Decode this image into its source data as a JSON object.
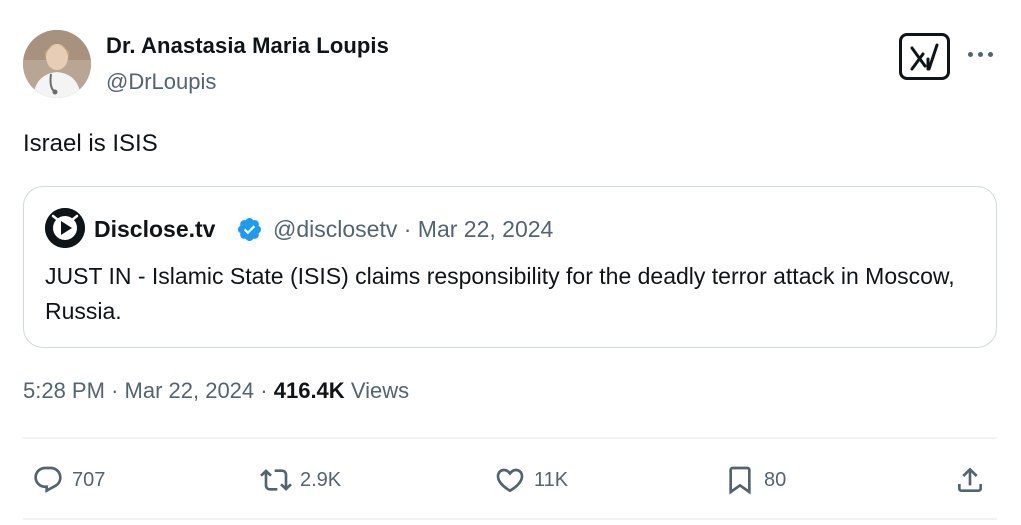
{
  "author": {
    "name": "Dr. Anastasia Maria Loupis",
    "handle": "@DrLoupis",
    "avatar_icon": "profile-photo-avatar"
  },
  "header_buttons": {
    "grok_icon": "grok-icon",
    "more_icon": "more-dots-icon"
  },
  "tweet": {
    "text": "Israel is ISIS"
  },
  "quoted_tweet": {
    "name": "Disclose.tv",
    "verified_icon": "verified-badge-icon",
    "handle": "@disclosetv",
    "separator": "·",
    "date": "Mar 22, 2024",
    "text": "JUST IN - Islamic State (ISIS) claims responsibility for the deadly terror attack in Moscow, Russia."
  },
  "meta": {
    "time": "5:28 PM",
    "separator": "·",
    "date": "Mar 22, 2024",
    "separator2": "·",
    "views_count": "416.4K",
    "views_label": "Views"
  },
  "actions": {
    "replies": "707",
    "reposts": "2.9K",
    "likes": "11K",
    "bookmarks": "80"
  },
  "colors": {
    "text_primary": "#0f1419",
    "text_secondary": "#536471",
    "border": "#cfd9de",
    "verified_blue": "#1d9bf0"
  }
}
